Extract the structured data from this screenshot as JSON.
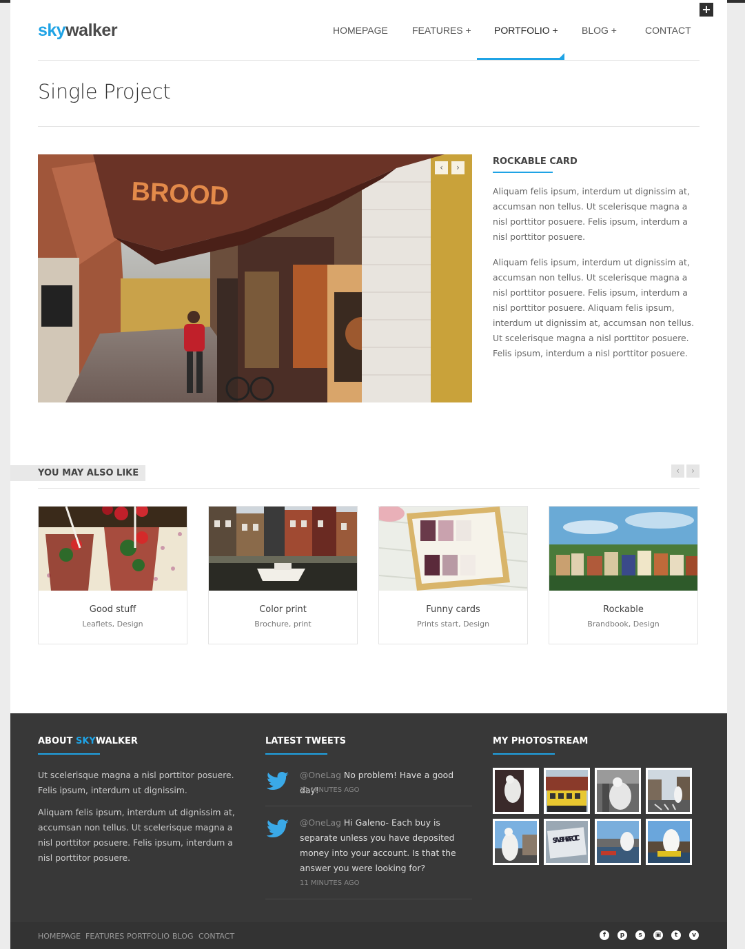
{
  "brand": {
    "sky": "sky",
    "walker": "walker"
  },
  "nav": {
    "items": [
      {
        "label": "Homepage"
      },
      {
        "label": "Features +"
      },
      {
        "label": "Portfolio +"
      },
      {
        "label": "Blog +"
      },
      {
        "label": "Contact"
      }
    ],
    "active_index": 2
  },
  "page": {
    "title": "Single Project"
  },
  "project": {
    "heading": "Rockable Card",
    "paragraphs": [
      "Aliquam felis ipsum, interdum ut dignissim at, accumsan non tellus. Ut scelerisque magna a nisl porttitor posuere. Felis ipsum, interdum a nisl porttitor posuere.",
      "Aliquam felis ipsum, interdum ut dignissim at, accumsan non tellus. Ut scelerisque magna a nisl porttitor posuere. Felis ipsum, interdum a nisl porttitor posuere. Aliquam felis ipsum, interdum ut dignissim at, accumsan non tellus. Ut scelerisque magna a nisl porttitor posuere. Felis ipsum, interdum a nisl porttitor posuere."
    ],
    "slider": {
      "prev_icon": "chevron-left-icon",
      "next_icon": "chevron-right-icon",
      "prev_glyph": "‹",
      "next_glyph": "›",
      "image_sign_text": "BROOD"
    }
  },
  "related": {
    "heading": "You may also like",
    "prev_glyph": "‹",
    "next_glyph": "›",
    "cards": [
      {
        "title": "Good stuff",
        "subtitle": "Leaflets, Design"
      },
      {
        "title": "Color print",
        "subtitle": "Brochure, print"
      },
      {
        "title": "Funny cards",
        "subtitle": "Prints start, Design"
      },
      {
        "title": "Rockable",
        "subtitle": "Brandbook, Design"
      }
    ]
  },
  "footer": {
    "about": {
      "heading_prefix": "About ",
      "heading_sky": "sky",
      "heading_walker": "walker",
      "paragraphs": [
        "Ut scelerisque magna a nisl porttitor posuere. Felis ipsum, interdum ut dignissim.",
        "Aliquam felis ipsum, interdum ut dignissim at, accumsan non tellus. Ut scelerisque magna a nisl porttitor posuere. Felis ipsum, interdum a nisl porttitor posuere."
      ]
    },
    "tweets": {
      "heading": "Latest Tweets",
      "items": [
        {
          "handle": "@OneLag",
          "text": " No problem! Have a good day!",
          "time": "11 minutes ago"
        },
        {
          "handle": "@OneLag",
          "text": " Hi Galeno- Each buy is separate unless you have deposited money into your account. Is that the answer you were looking for?",
          "time": "11 minutes ago"
        }
      ]
    },
    "photostream": {
      "heading": "My Photostream",
      "count": 8,
      "sign_text": "SAVE THE ARCTIC"
    }
  },
  "bottom": {
    "links": [
      "Homepage",
      "Features",
      "Portfolio",
      "Blog",
      "Contact"
    ],
    "social": [
      {
        "icon": "facebook-icon",
        "glyph": "f"
      },
      {
        "icon": "pinterest-icon",
        "glyph": "p"
      },
      {
        "icon": "skype-icon",
        "glyph": "s"
      },
      {
        "icon": "flickr-icon",
        "glyph": "▣"
      },
      {
        "icon": "twitter-icon",
        "glyph": "t"
      },
      {
        "icon": "vimeo-icon",
        "glyph": "v"
      }
    ]
  },
  "colors": {
    "accent": "#1fa3e5",
    "footer_bg": "#383838",
    "bottom_bg": "#333333"
  },
  "plus_glyph": "+"
}
